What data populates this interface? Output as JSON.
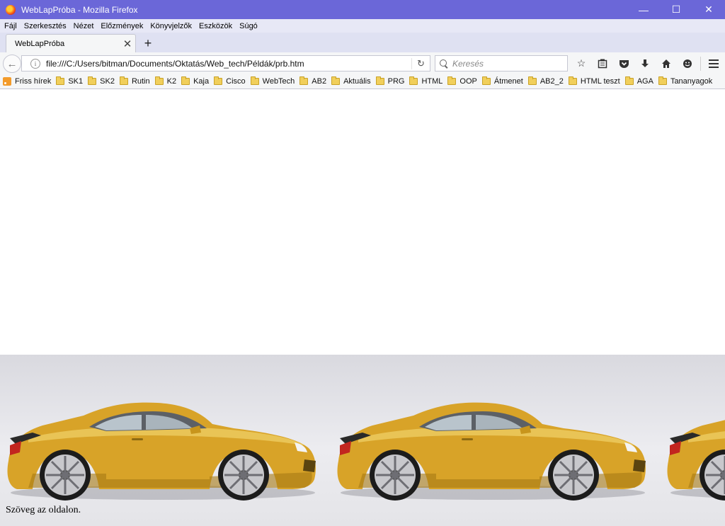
{
  "window": {
    "title": "WebLapPróba - Mozilla Firefox",
    "minimize": "—",
    "maximize": "☐",
    "close": "✕"
  },
  "menu": [
    "Fájl",
    "Szerkesztés",
    "Nézet",
    "Előzmények",
    "Könyvjelzők",
    "Eszközök",
    "Súgó"
  ],
  "tab": {
    "title": "WebLapPróba",
    "close": "✕",
    "new_tab": "+"
  },
  "nav": {
    "back": "←",
    "url": "file:///C:/Users/bitman/Documents/Oktatás/Web_tech/Példák/prb.htm",
    "reload": "↻",
    "search_placeholder": "Keresés",
    "tools": [
      "bookmark-star-icon",
      "reading-list-icon",
      "pocket-icon",
      "download-icon",
      "home-icon",
      "smiley-icon",
      "menu-icon"
    ]
  },
  "bookmarks": [
    {
      "label": "Friss hírek",
      "icon": "rss-icon"
    },
    {
      "label": "SK1",
      "icon": "folder-icon"
    },
    {
      "label": "SK2",
      "icon": "folder-icon"
    },
    {
      "label": "Rutin",
      "icon": "folder-icon"
    },
    {
      "label": "K2",
      "icon": "folder-icon"
    },
    {
      "label": "Kaja",
      "icon": "folder-icon"
    },
    {
      "label": "Cisco",
      "icon": "folder-icon"
    },
    {
      "label": "WebTech",
      "icon": "folder-icon"
    },
    {
      "label": "AB2",
      "icon": "folder-icon"
    },
    {
      "label": "Aktuális",
      "icon": "folder-icon"
    },
    {
      "label": "PRG",
      "icon": "folder-icon"
    },
    {
      "label": "HTML",
      "icon": "folder-icon"
    },
    {
      "label": "OOP",
      "icon": "folder-icon"
    },
    {
      "label": "Átmenet",
      "icon": "folder-icon"
    },
    {
      "label": "AB2_2",
      "icon": "folder-icon"
    },
    {
      "label": "HTML teszt",
      "icon": "folder-icon"
    },
    {
      "label": "AGA",
      "icon": "folder-icon"
    },
    {
      "label": "Tananyagok",
      "icon": "folder-icon"
    }
  ],
  "page": {
    "text": "Szöveg az oldalon.",
    "colors": {
      "car_body": "#d9a626",
      "titlebar": "#6b67d8"
    }
  }
}
